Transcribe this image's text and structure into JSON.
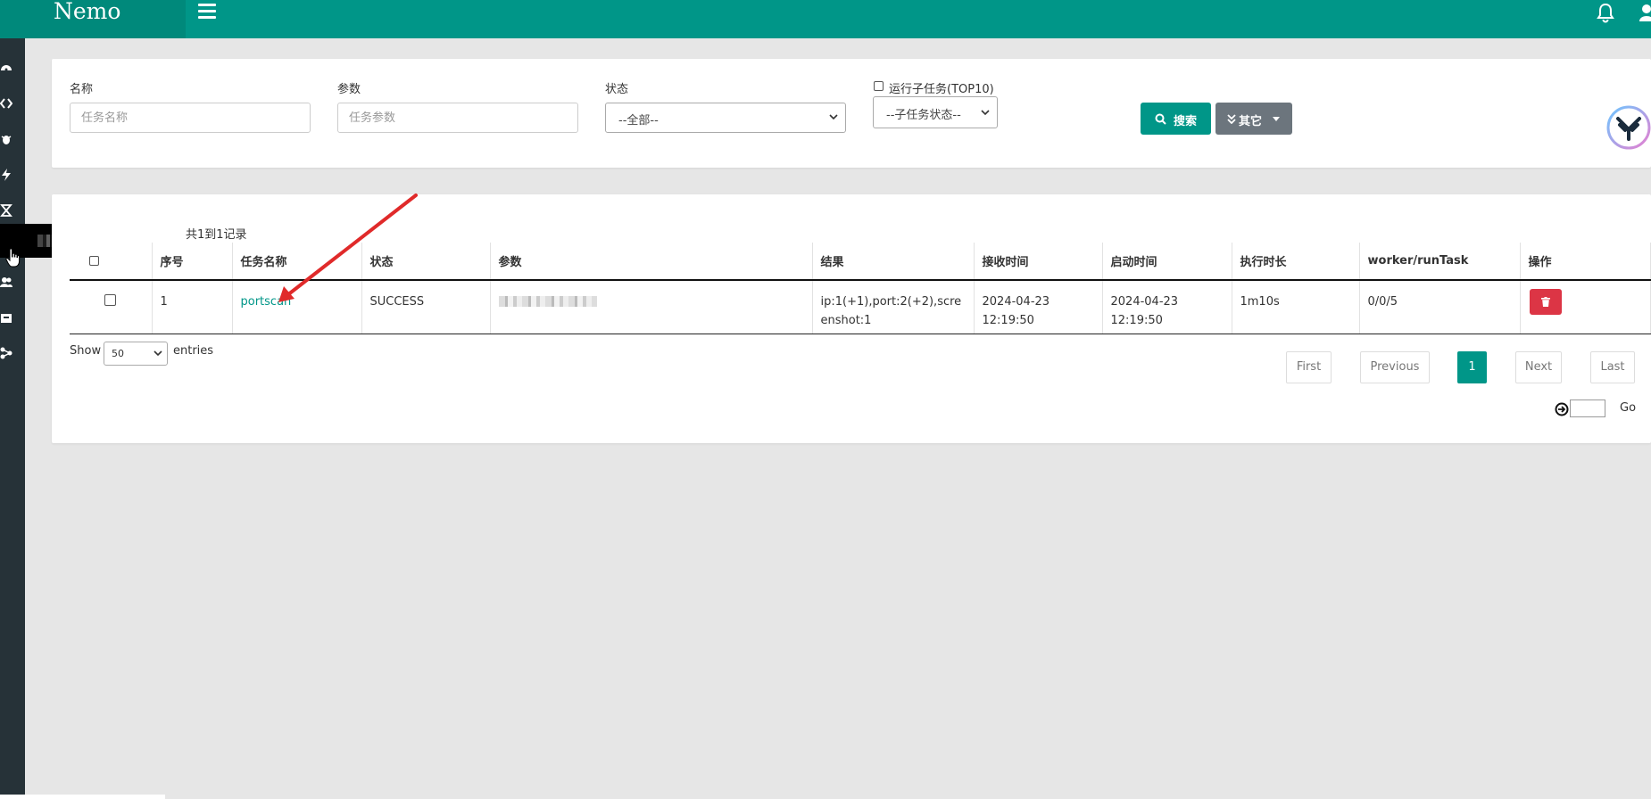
{
  "app": {
    "brand": "Nemo"
  },
  "colors": {
    "primary": "#009688",
    "danger": "#dc3545",
    "secondary": "#6c757d",
    "sidebar": "#263238"
  },
  "sidebar": {
    "icons": [
      "dashboard-icon",
      "code-icon",
      "bug-icon",
      "lightning-icon",
      "hourglass-icon",
      "server-icon",
      "users-icon",
      "archive-icon",
      "network-icon"
    ],
    "tooltip_text": ""
  },
  "filters": {
    "name_label": "名称",
    "name_placeholder": "任务名称",
    "param_label": "参数",
    "param_placeholder": "任务参数",
    "status_label": "状态",
    "status_value": "--全部--",
    "subtask_label": "运行子任务(TOP10)",
    "subtask_status_value": "--子任务状态--",
    "search_button": "搜索",
    "other_button": "其它"
  },
  "table": {
    "info": "共1到1记录",
    "columns": [
      "",
      "序号",
      "任务名称",
      "状态",
      "参数",
      "结果",
      "接收时间",
      "启动时间",
      "执行时长",
      "worker/runTask",
      "操作"
    ],
    "rows": [
      {
        "index": "1",
        "task_name": "portscan",
        "status": "SUCCESS",
        "params": "",
        "result": "ip:1(+1),port:2(+2),screenshot:1",
        "received_time": "2024-04-23 12:19:50",
        "started_time": "2024-04-23 12:19:50",
        "duration": "1m10s",
        "worker_runtask": "0/0/5"
      }
    ]
  },
  "length": {
    "show": "Show",
    "value": "50",
    "entries": "entries"
  },
  "pagination": {
    "first": "First",
    "previous": "Previous",
    "current": "1",
    "next": "Next",
    "last": "Last",
    "go": "Go"
  }
}
